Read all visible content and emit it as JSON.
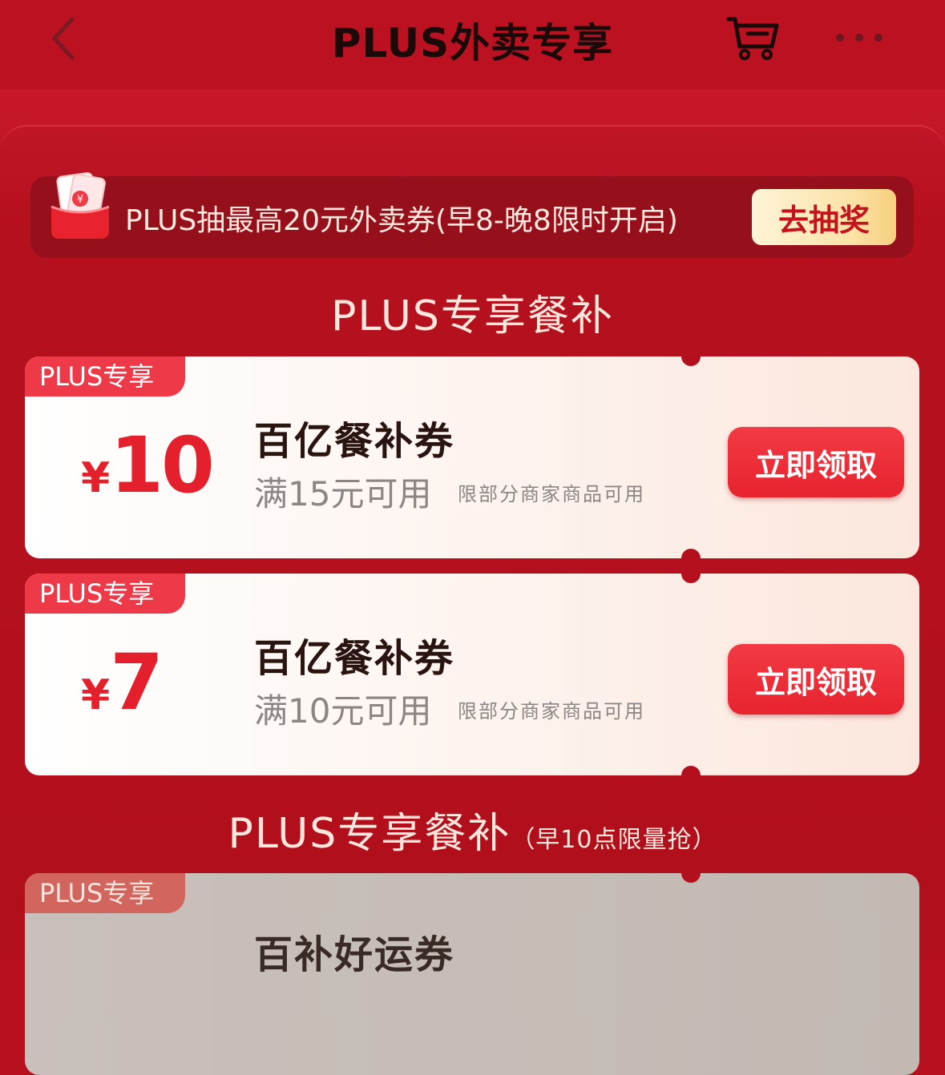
{
  "header": {
    "title": "PLUS外卖专享",
    "back_icon": "chevron-left-icon",
    "cart_icon": "cart-icon",
    "more_icon": "more-dots-icon"
  },
  "lottery": {
    "text": "PLUS抽最高20元外卖券(早8-晚8限时开启)",
    "button": "去抽奖",
    "icon": "red-envelope-icon"
  },
  "sections": [
    {
      "title": "PLUS专享餐补",
      "subtitle": ""
    },
    {
      "title": "PLUS专享餐补",
      "subtitle": "（早10点限量抢）"
    }
  ],
  "coupons": [
    {
      "badge": "PLUS专享",
      "currency": "¥",
      "amount": "10",
      "name": "百亿餐补券",
      "condition": "满15元可用",
      "note": "限部分商家商品可用",
      "button": "立即领取"
    },
    {
      "badge": "PLUS专享",
      "currency": "¥",
      "amount": "7",
      "name": "百亿餐补券",
      "condition": "满10元可用",
      "note": "限部分商家商品可用",
      "button": "立即领取"
    },
    {
      "badge": "PLUS专享",
      "name": "百补好运券"
    }
  ],
  "colors": {
    "brand_red": "#b8101e",
    "button_red": "#e7232e",
    "price_red": "#e3202c",
    "gold": "#fbe2a6"
  }
}
